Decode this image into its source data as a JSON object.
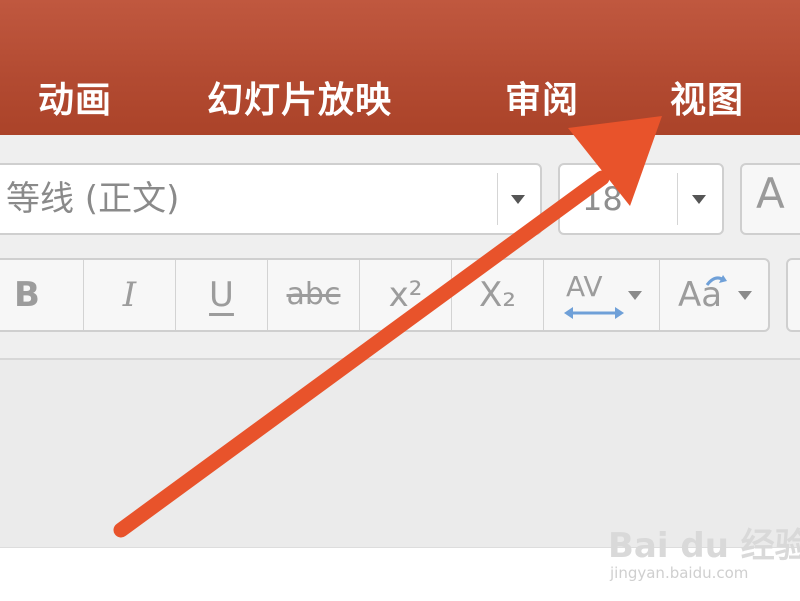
{
  "ribbon_tabs": [
    {
      "label": "动画"
    },
    {
      "label": "幻灯片放映"
    },
    {
      "label": "审阅"
    },
    {
      "label": "视图"
    }
  ],
  "font_name": {
    "value": "等线 (正文)"
  },
  "font_size": {
    "value": "18"
  },
  "grow_font": {
    "glyph": "A"
  },
  "format_buttons": {
    "bold": "B",
    "italic": "I",
    "underline": "U",
    "strikethrough": "abc",
    "superscript": "x²",
    "subscript": "X₂",
    "char_spacing": "AV",
    "change_case": "Aa"
  },
  "watermark": {
    "logo_text": "Bai du 经验",
    "url": "jingyan.baidu.com"
  },
  "colors": {
    "tab_bar": "#b24a31",
    "tab_text": "#ffffff",
    "annotation_arrow": "#e8532b"
  }
}
